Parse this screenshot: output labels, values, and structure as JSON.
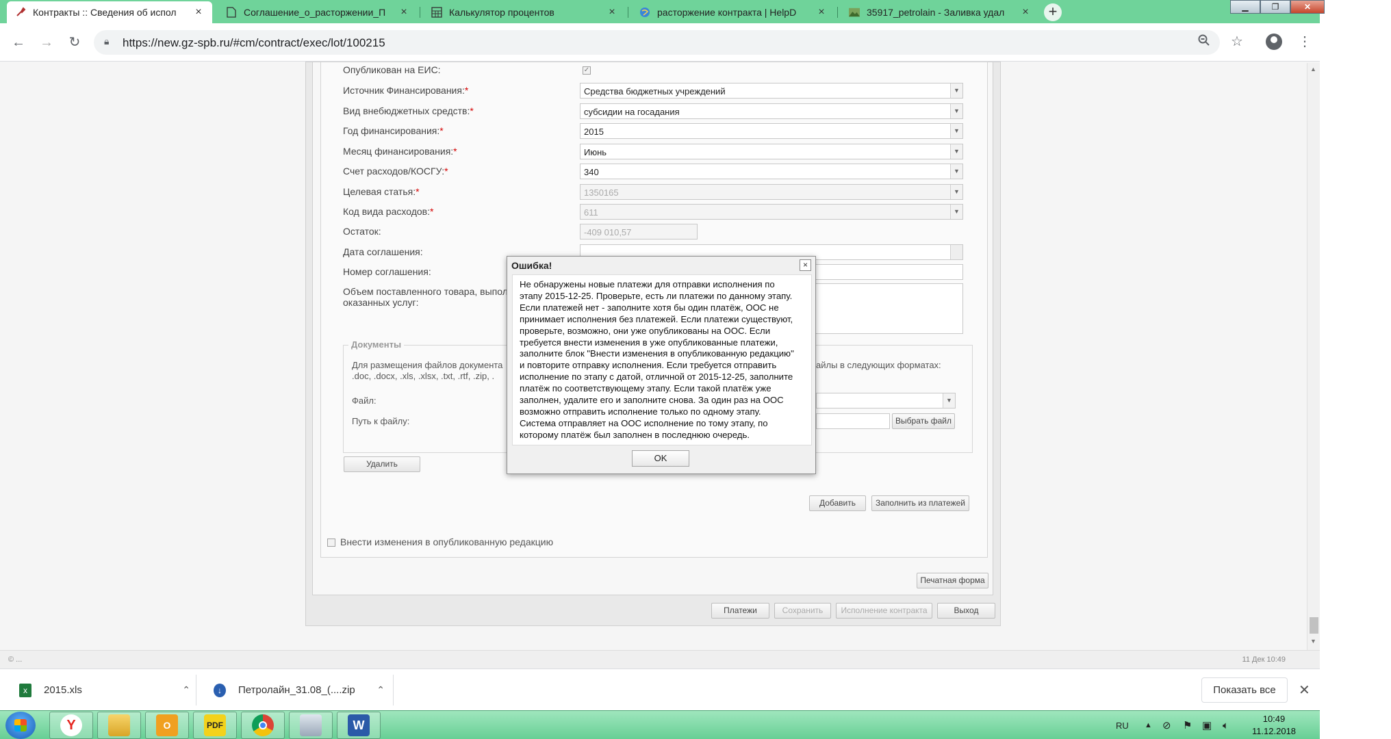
{
  "browser": {
    "tabs": [
      {
        "label": "Контракты :: Сведения об испол",
        "icon": "tool-icon",
        "active": true
      },
      {
        "label": "Соглашение_о_расторжении_П",
        "icon": "document-icon",
        "active": false
      },
      {
        "label": "Калькулятор процентов",
        "icon": "calculator-icon",
        "active": false
      },
      {
        "label": "расторжение контракта | HelpD",
        "icon": "globe-icon",
        "active": false
      },
      {
        "label": "35917_petrolain - Заливка удал",
        "icon": "image-icon",
        "active": false
      }
    ],
    "url": "https://new.gz-spb.ru/#cm/contract/exec/lot/100215"
  },
  "form": {
    "published_label": "Опубликован на ЕИС:",
    "published_check": "✓",
    "fields": [
      {
        "label": "Источник Финансирования:",
        "value": "Средства бюджетных учреждений",
        "required": "*"
      },
      {
        "label": "Вид внебюджетных средств:",
        "value": "субсидии на госадания",
        "required": "*"
      },
      {
        "label": "Год финансирования:",
        "value": "2015",
        "required": "*"
      },
      {
        "label": "Месяц финансирования:",
        "value": "Июнь",
        "required": "*"
      },
      {
        "label": "Счет расходов/КОСГУ:",
        "value": "340",
        "required": "*"
      },
      {
        "label": "Целевая статья:",
        "value": "1350165",
        "required": "*"
      },
      {
        "label": "Код вида расходов:",
        "value": "611",
        "required": "*"
      }
    ],
    "remainder_label": "Остаток:",
    "remainder_value": "-409 010,57",
    "agreement_date_label": "Дата соглашения:",
    "agreement_number_label": "Номер соглашения:",
    "volume_label_1": "Объем поставленного товара, выполн",
    "volume_label_2": "оказанных услуг:",
    "documents_legend": "Документы",
    "docs_text_1": "Для размещения файлов документа",
    "docs_text_2": ".doc, .docx, .xls, .xlsx, .txt, .rtf, .zip, .",
    "docs_text_right": "айлы в следующих форматах:",
    "file_label": "Файл:",
    "path_label": "Путь к файлу:",
    "choose_file_button": "Выбрать файл",
    "delete_button": "Удалить",
    "add_button": "Добавить",
    "fill_from_payments_button": "Заполнить из платежей",
    "amend_label": "Внести изменения в опубликованную редакцию",
    "print_form_button": "Печатная форма",
    "bottom_buttons": [
      "Платежи",
      "Сохранить",
      "Исполнение контракта",
      "Выход"
    ]
  },
  "statusbar": {
    "left": "© ...",
    "right": "11 Дек 10:49"
  },
  "modal": {
    "title": "Ошибка!",
    "close": "×",
    "lines": [
      "Не обнаружены новые платежи для отправки исполнения по",
      "этапу 2015-12-25. Проверьте, есть ли платежи по данному этапу.",
      "Если платежей нет - заполните хотя бы один платёж, ООС не",
      "принимает исполнения без платежей. Если платежи существуют,",
      "проверьте, возможно, они уже опубликованы на ООС. Если",
      "требуется внести изменения в уже опубликованные платежи,",
      "заполните блок \"Внести изменения в опубликованную редакцию\"",
      "и повторите отправку исполнения. Если требуется отправить",
      "исполнение по этапу с датой, отличной от 2015-12-25, заполните",
      "платёж по соответствующему этапу. Если такой платёж уже",
      "заполнен, удалите его и заполните снова. За один раз на ООС",
      "возможно отправить исполнение только по одному этапу.",
      "Система отправляет на ООС исполнение по тому этапу, по",
      "которому платёж был заполнен в последнюю очередь."
    ],
    "ok_button": "OK"
  },
  "downloads": {
    "items": [
      {
        "name": "2015.xls",
        "icon": "excel-file-icon"
      },
      {
        "name": "Петролайн_31.08_(....zip",
        "icon": "archive-file-icon"
      }
    ],
    "show_all": "Показать все"
  },
  "taskbar": {
    "apps": [
      "yandex-browser-icon",
      "file-explorer-icon",
      "outlook-icon",
      "pdf-reader-icon",
      "chrome-icon",
      "calculator-icon",
      "word-icon"
    ],
    "language": "RU",
    "time": "10:49",
    "date": "11.12.2018"
  },
  "colors": {
    "tabbar": "#6fd39a",
    "required": "#d40000",
    "taskbar": "#67cf95"
  }
}
